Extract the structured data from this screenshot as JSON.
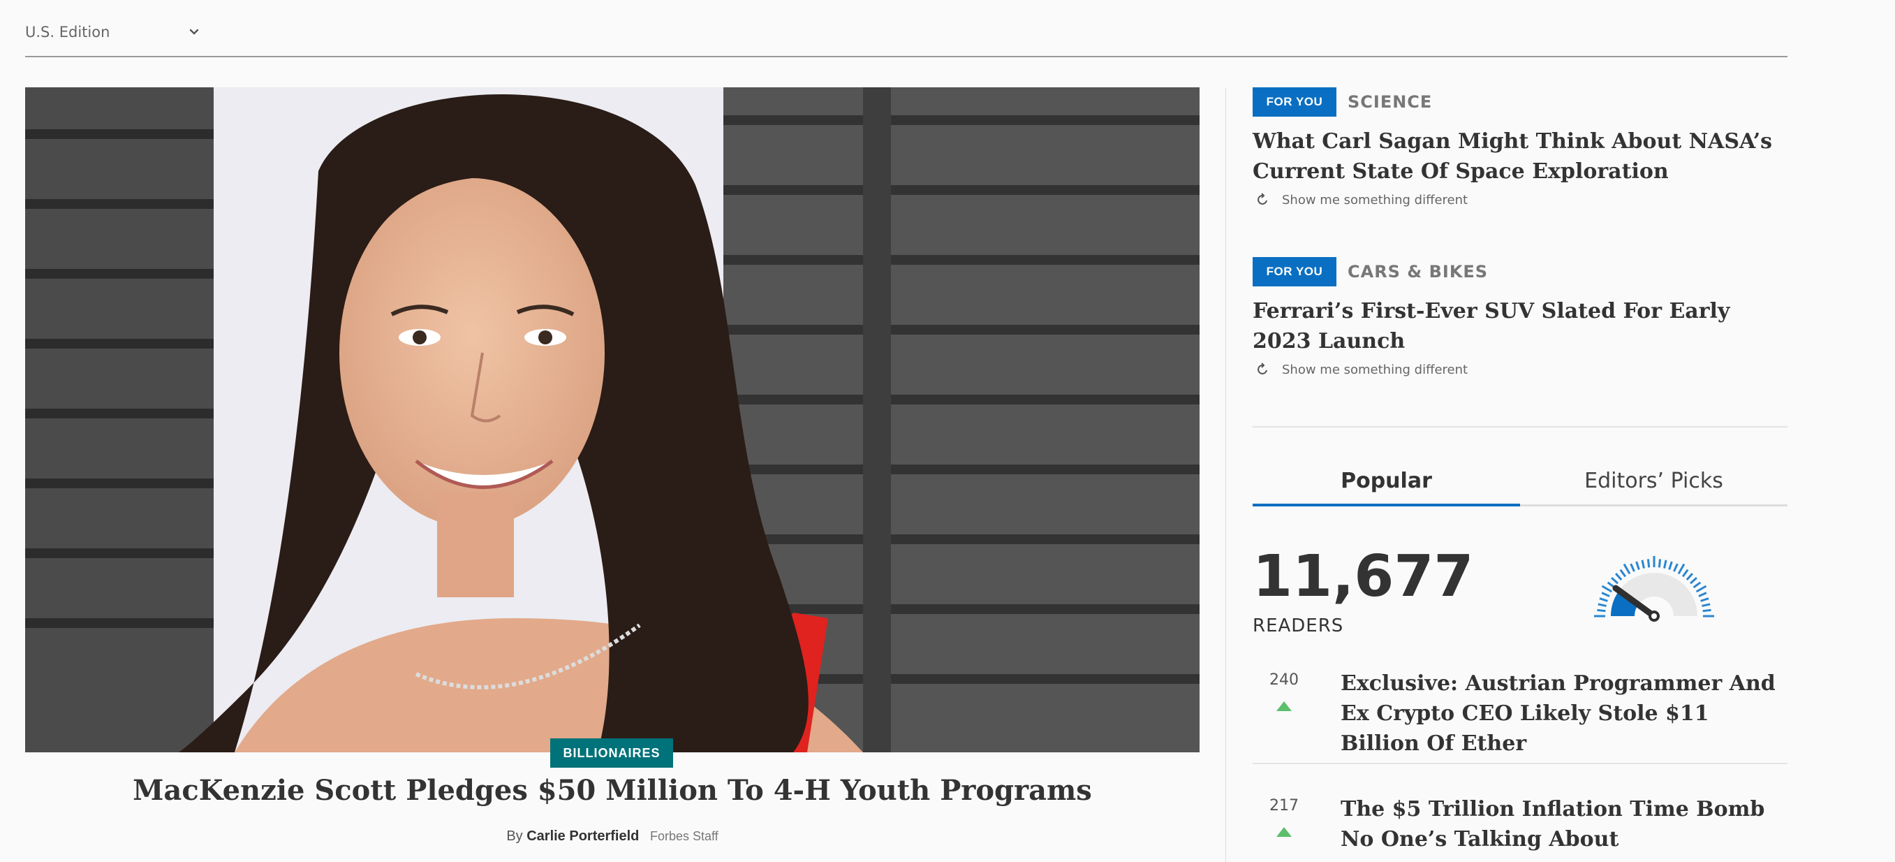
{
  "edition": {
    "label": "U.S. Edition",
    "chevron_icon": "chevron-down-icon"
  },
  "hero": {
    "category": "BILLIONAIRES",
    "title": "MacKenzie Scott Pledges $50 Million To 4-H Youth Programs",
    "byline_prefix": "By",
    "author": "Carlie Porterfield",
    "author_role": "Forbes Staff"
  },
  "for_you": [
    {
      "badge": "FOR YOU",
      "channel": "SCIENCE",
      "headline": "What Carl Sagan Might Think About NASA’s Current State Of Space Exploration",
      "refresh_label": "Show me something different"
    },
    {
      "badge": "FOR YOU",
      "channel": "CARS & BIKES",
      "headline": "Ferrari’s First-Ever SUV Slated For Early 2023 Launch",
      "refresh_label": "Show me something different"
    }
  ],
  "tabs": [
    {
      "label": "Popular",
      "active": true
    },
    {
      "label": "Editors’ Picks",
      "active": false
    }
  ],
  "readers": {
    "count": "11,677",
    "label": "READERS",
    "gauge_level": 0.2
  },
  "popular": [
    {
      "count": "240",
      "title": "Exclusive: Austrian Programmer And Ex Crypto CEO Likely Stole $11 Billion Of Ether"
    },
    {
      "count": "217",
      "title": "The $5 Trillion Inflation Time Bomb No One’s Talking About"
    }
  ],
  "colors": {
    "accent_blue": "#0a6fc2",
    "category_teal": "#00727a",
    "trend_green": "#5bbf6b"
  }
}
